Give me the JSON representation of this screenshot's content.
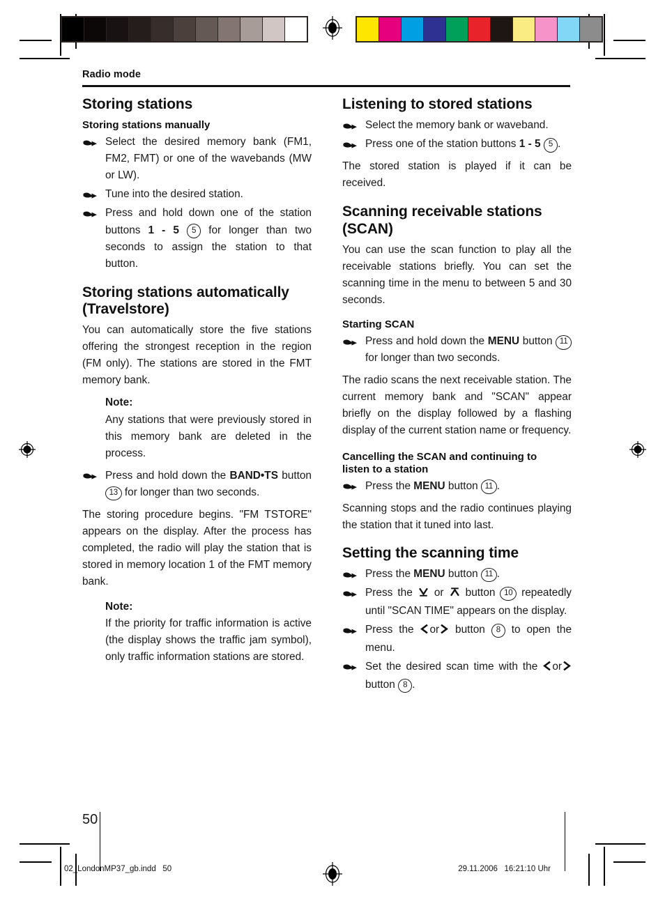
{
  "document": {
    "running_head": "Radio mode",
    "page_number": "50",
    "footer_left": "02_LondonMP37_gb.indd   50",
    "footer_right": "29.11.2006   16:21:10 Uhr"
  },
  "color_bars": {
    "grayscale": [
      "#000000",
      "#0b0807",
      "#181312",
      "#241d1b",
      "#372d2b",
      "#4c403d",
      "#655956",
      "#837672",
      "#a89c98",
      "#d1c6c3",
      "#ffffff"
    ],
    "color": [
      "#ffe600",
      "#e6007e",
      "#009fe3",
      "#2e3192",
      "#00a05a",
      "#e8232a",
      "#1d1613",
      "#faec82",
      "#f693c8",
      "#82d7f7",
      "#8c8c8c"
    ]
  },
  "left_column": {
    "heading": "Storing stations",
    "sub1": {
      "heading": "Storing stations manually",
      "steps": [
        "Select the desired memory bank (FM1, FM2, FMT) or one of the wavebands (MW or LW).",
        "Tune into the desired station.",
        "Press and hold down one of the station buttons 1 - 5 ⑤ for longer than two seconds to assign the station to that button."
      ],
      "step3_parts": {
        "pre": "Press and hold down one of the station buttons ",
        "bold": "1 - 5",
        "ref": "5",
        "post": " for longer than two seconds to assign the station to that button."
      }
    },
    "sub2": {
      "heading_line1": "Storing stations automatically",
      "heading_line2": "(Travelstore)",
      "para1": "You can automatically store the five stations offering the strongest reception in the region (FM only). The stations are stored in the FMT memory bank.",
      "note1_title": "Note:",
      "note1_text": "Any stations that were previously stored in this memory bank are deleted in the process.",
      "step_bandts": {
        "pre": "Press and hold down the ",
        "bold": "BAND•TS",
        "mid": " button ",
        "ref": "13",
        "post": " for longer than two seconds."
      },
      "para2": "The storing procedure begins. \"FM TSTORE\" appears on the display. After the process has completed, the radio will play the station that is stored in memory location 1 of the FMT memory bank.",
      "note2_title": "Note:",
      "note2_text": "If the priority for traffic information is active (the display shows the traffic jam symbol), only traffic information stations are stored."
    }
  },
  "right_column": {
    "sec1": {
      "heading": "Listening to stored stations",
      "step1": "Select the memory bank or waveband.",
      "step2": {
        "pre": "Press one of the station buttons ",
        "bold": "1 - 5",
        "ref": "5",
        "post": "."
      },
      "para": "The stored station is played if it can be received."
    },
    "sec2": {
      "heading_line1": "Scanning receivable stations",
      "heading_line2": "(SCAN)",
      "para": "You can use the scan function to play all the receivable stations briefly. You can set the scanning time in the menu to between 5 and 30 seconds.",
      "sub_heading": "Starting SCAN",
      "step": {
        "pre": "Press and hold down the ",
        "bold": "MENU",
        "mid": " button ",
        "ref": "11",
        "post": " for longer than two seconds."
      },
      "para2": "The radio scans the next receivable station. The current memory bank and \"SCAN\" appear briefly on the display followed by a flashing display of the current station name or frequency."
    },
    "sec3": {
      "heading_line1": "Cancelling the SCAN and continuing to",
      "heading_line2": "listen to a station",
      "step": {
        "pre": "Press the ",
        "bold": "MENU",
        "mid": " button ",
        "ref": "11",
        "post": "."
      },
      "para": "Scanning stops and the radio continues playing the station that it tuned into last."
    },
    "sec4": {
      "heading": "Setting the scanning time",
      "step1": {
        "pre": "Press the ",
        "bold": "MENU",
        "mid": " button ",
        "ref": "11",
        "post": "."
      },
      "step2": {
        "pre": "Press the ",
        "sym1": "down-bar-arrow",
        "mid1": " or ",
        "sym2": "up-bar-arrow",
        "mid2": " button ",
        "ref": "10",
        "post": " repeatedly until \"SCAN TIME\" appears on the display."
      },
      "step3": {
        "pre": "Press the ",
        "sym1": "left-chevron",
        "mid1": "or",
        "sym2": "right-chevron",
        "mid2": " button ",
        "ref": "8",
        "post": " to open the menu."
      },
      "step4": {
        "pre": "Set the desired scan time with the ",
        "sym1": "left-chevron",
        "mid1": "or",
        "sym2": "right-chevron",
        "mid2": " button ",
        "ref": "8",
        "post": "."
      }
    }
  }
}
